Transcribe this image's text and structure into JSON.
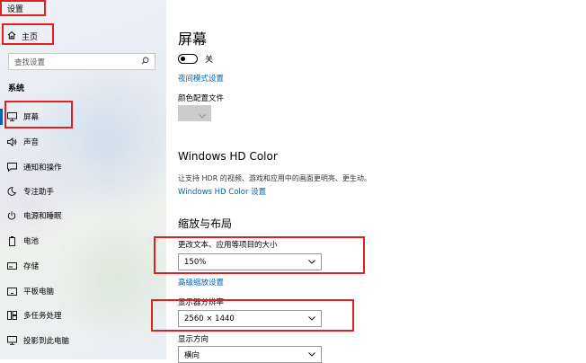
{
  "app": {
    "title": "设置"
  },
  "sidebar": {
    "home_label": "主页",
    "search_placeholder": "查找设置",
    "section_title": "系统",
    "items": [
      {
        "label": "屏幕",
        "icon": "monitor-icon"
      },
      {
        "label": "声音",
        "icon": "speaker-icon"
      },
      {
        "label": "通知和操作",
        "icon": "notification-icon"
      },
      {
        "label": "专注助手",
        "icon": "moon-icon"
      },
      {
        "label": "电源和睡眠",
        "icon": "power-icon"
      },
      {
        "label": "电池",
        "icon": "battery-icon"
      },
      {
        "label": "存储",
        "icon": "storage-icon"
      },
      {
        "label": "平板电脑",
        "icon": "tablet-icon"
      },
      {
        "label": "多任务处理",
        "icon": "multitask-icon"
      },
      {
        "label": "投影到此电脑",
        "icon": "project-icon"
      }
    ]
  },
  "main": {
    "page_title": "屏幕",
    "night_light_state": "关",
    "night_light_link": "夜间模式设置",
    "color_profile_label": "颜色配置文件",
    "hd_color_heading": "Windows HD Color",
    "hd_color_desc": "让支持 HDR 的视频、游戏和应用中的画面更明亮、更生动。",
    "hd_color_link": "Windows HD Color 设置",
    "scale_heading": "缩放与布局",
    "scale_label": "更改文本、应用等项目的大小",
    "scale_value": "150%",
    "advanced_scaling_link": "高级缩放设置",
    "resolution_label": "显示器分辨率",
    "resolution_value": "2560 × 1440",
    "orientation_label": "显示方向",
    "orientation_value": "横向"
  },
  "colors": {
    "accent": "#0063b1",
    "annotation": "#e32020"
  }
}
